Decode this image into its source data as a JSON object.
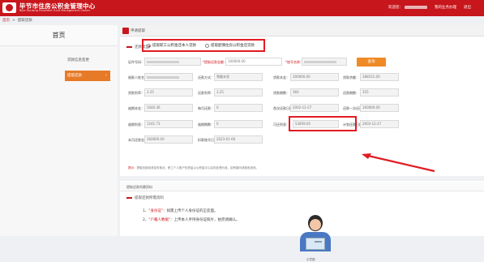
{
  "header": {
    "title": "毕节市住房公积金管理中心",
    "subtitle": "Bijie Housing Provident Fund Management Center",
    "welcome": "欢迎您：",
    "user_masked": "",
    "links": [
      "我的业务办理",
      "退出"
    ]
  },
  "breadcrumb": {
    "home": "首页",
    "sep": ">",
    "current": "提取还款"
  },
  "sidebar": {
    "title": "首页",
    "items": [
      {
        "label": "贷款信息变更",
        "active": false
      },
      {
        "label": "提取还款",
        "active": true
      }
    ]
  },
  "panel": {
    "title": "申请提取",
    "section1": "还款类型",
    "radio_options": [
      {
        "label": "提取职工公积金还本人贷款",
        "checked": true
      },
      {
        "label": "提取配偶住房公积金还贷款",
        "checked": false
      }
    ],
    "query_button": "查询",
    "fields": [
      {
        "label": "证件号码：",
        "value": "",
        "required": false,
        "masked": true
      },
      {
        "label": "*提取还款金额：",
        "value": "100000.00",
        "required": true,
        "masked": false
      },
      {
        "label": "*账号名称：",
        "value": "",
        "required": true,
        "masked": true
      },
      {
        "label": "借款人姓名：",
        "value": "",
        "required": false,
        "masked": true
      },
      {
        "label": "还款方式：",
        "value": "等额本息",
        "required": false,
        "masked": false
      },
      {
        "label": "贷款本金：",
        "value": "300000.00",
        "required": false,
        "masked": false
      },
      {
        "label": "贷款余额：",
        "value": "288531.00",
        "required": false,
        "masked": false
      },
      {
        "label": "贷款利率：",
        "value": "3.25",
        "required": false,
        "masked": false
      },
      {
        "label": "还款利率：",
        "value": "3.25",
        "required": false,
        "masked": false
      },
      {
        "label": "贷款期数：",
        "value": "360",
        "required": false,
        "masked": false
      },
      {
        "label": "还款期数：",
        "value": "355",
        "required": false,
        "masked": false
      },
      {
        "label": "逾期本金：",
        "value": "1040.36",
        "required": false,
        "masked": false
      },
      {
        "label": "每月还款：",
        "value": "0",
        "required": false,
        "masked": false
      },
      {
        "label": "首次还款日期：",
        "value": "2002-12-27",
        "required": false,
        "masked": false
      },
      {
        "label": "还款一次还款额：",
        "value": "160000.00",
        "required": false,
        "masked": false
      },
      {
        "label": "逾期利息：",
        "value": "1241.73",
        "required": false,
        "masked": false
      },
      {
        "label": "逾期期数：",
        "value": "0",
        "required": false,
        "masked": false
      },
      {
        "label": "可还利息：",
        "value": "53859.65",
        "required": false,
        "masked": false
      },
      {
        "label": "计划还款日期：",
        "value": "2002-12-27",
        "required": false,
        "masked": false
      },
      {
        "label": "本月还款金额：",
        "value": "160000.00",
        "required": false,
        "masked": false
      },
      {
        "label": "扣款账号日期：",
        "value": "2023-01-06",
        "required": false,
        "masked": false
      }
    ],
    "note_red": "提示：",
    "note": "提取还款前请及时核对，职工个人账户的资金以公积金中心实际处理为准，如有疑问请致电咨询。"
  },
  "upload": {
    "title": "提取还款所需资料",
    "items": [
      {
        "num": "1、",
        "hl": "\"身份证\"",
        "rest": "：如需上传个人身份证的正反面。"
      },
      {
        "num": "2、",
        "hl": "\"户籍人数据\"",
        "rest": "：上传本人手持身份证照片，拍完请确认。"
      }
    ],
    "caption": "示意图"
  },
  "colors": {
    "brand": "#c8161d",
    "accent": "#e77a27",
    "highlight": "#e21b23"
  }
}
